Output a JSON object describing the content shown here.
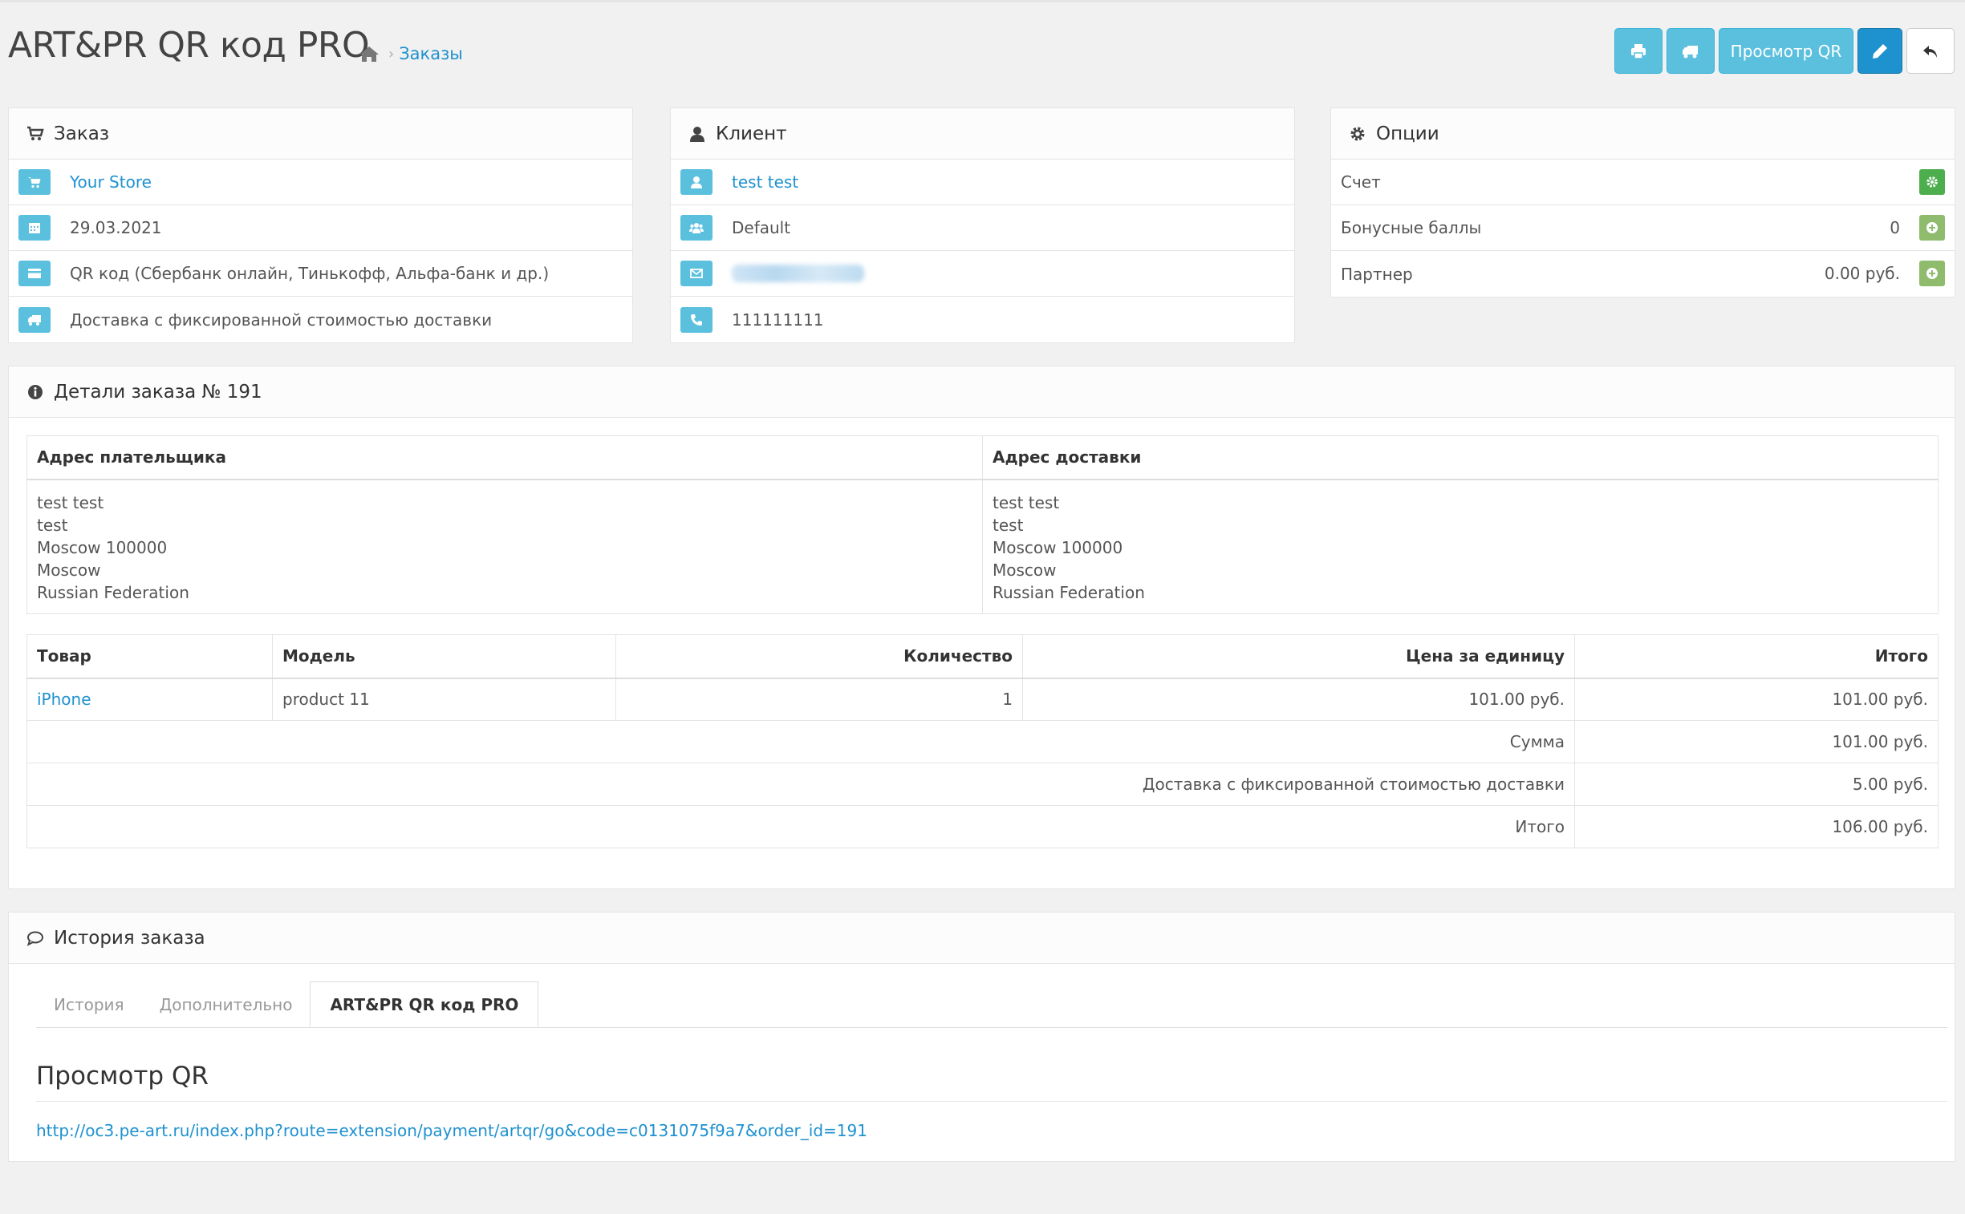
{
  "header": {
    "title": "ART&PR QR код PRO",
    "breadcrumb": "Заказы",
    "buttons": {
      "print_icon": "print-icon",
      "ship_icon": "truck-icon",
      "qr_view": "Просмотр QR",
      "edit_icon": "pencil-icon",
      "back_icon": "reply-icon"
    }
  },
  "order_panel": {
    "title": "Заказ",
    "store": "Your Store",
    "date": "29.03.2021",
    "payment": "QR код (Сбербанк онлайн, Тинькофф, Альфа-банк и др.)",
    "shipping": "Доставка с фиксированной стоимостью доставки"
  },
  "customer_panel": {
    "title": "Клиент",
    "name": "test test",
    "group": "Default",
    "phone": "111111111"
  },
  "options_panel": {
    "title": "Опции",
    "invoice_label": "Счет",
    "reward_label": "Бонусные баллы",
    "reward_value": "0",
    "affiliate_label": "Партнер",
    "affiliate_value": "0.00 руб."
  },
  "details": {
    "title": "Детали заказа № 191",
    "payment_address_header": "Адрес плательщика",
    "shipping_address_header": "Адрес доставки",
    "payment_address": [
      "test test",
      "test",
      "Moscow 100000",
      "Moscow",
      "Russian Federation"
    ],
    "shipping_address": [
      "test test",
      "test",
      "Moscow 100000",
      "Moscow",
      "Russian Federation"
    ],
    "columns": [
      "Товар",
      "Модель",
      "Количество",
      "Цена за единицу",
      "Итого"
    ],
    "product": {
      "name": "iPhone",
      "model": "product 11",
      "quantity": "1",
      "price": "101.00 руб.",
      "total": "101.00 руб."
    },
    "totals": [
      {
        "label": "Сумма",
        "value": "101.00 руб."
      },
      {
        "label": "Доставка с фиксированной стоимостью доставки",
        "value": "5.00 руб."
      },
      {
        "label": "Итого",
        "value": "106.00 руб."
      }
    ]
  },
  "history": {
    "title": "История заказа",
    "tabs": [
      "История",
      "Дополнительно",
      "ART&PR QR код PRO"
    ],
    "qr_heading": "Просмотр QR",
    "qr_link": "http://oc3.pe-art.ru/index.php?route=extension/payment/artqr/go&code=c0131075f9a7&order_id=191"
  }
}
